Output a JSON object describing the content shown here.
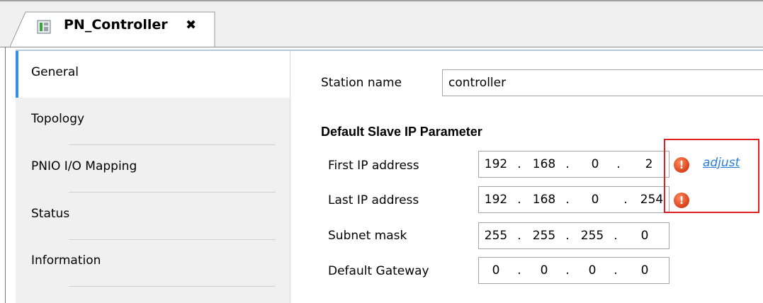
{
  "tab": {
    "title": "PN_Controller",
    "close": "✖"
  },
  "sidebar": {
    "items": [
      {
        "label": "General"
      },
      {
        "label": "Topology"
      },
      {
        "label": "PNIO I/O Mapping"
      },
      {
        "label": "Status"
      },
      {
        "label": "Information"
      }
    ],
    "selected": "General"
  },
  "form": {
    "station_name_label": "Station name",
    "station_name_value": "controller",
    "section_title": "Default Slave IP Parameter",
    "first_ip": {
      "label": "First IP address",
      "octets": [
        "192",
        "168",
        "0",
        "2"
      ]
    },
    "last_ip": {
      "label": "Last IP address",
      "octets": [
        "192",
        "168",
        "0",
        "254"
      ]
    },
    "subnet": {
      "label": "Subnet mask",
      "octets": [
        "255",
        "255",
        "255",
        "0"
      ]
    },
    "gateway": {
      "label": "Default Gateway",
      "octets": [
        "0",
        "0",
        "0",
        "0"
      ]
    },
    "dot": ".",
    "error_glyph": "!",
    "adjust_link": "adjust"
  },
  "colors": {
    "accent": "#3b8fe3",
    "error": "#d8401a",
    "link": "#2a7de0",
    "highlight": "#e02020"
  }
}
